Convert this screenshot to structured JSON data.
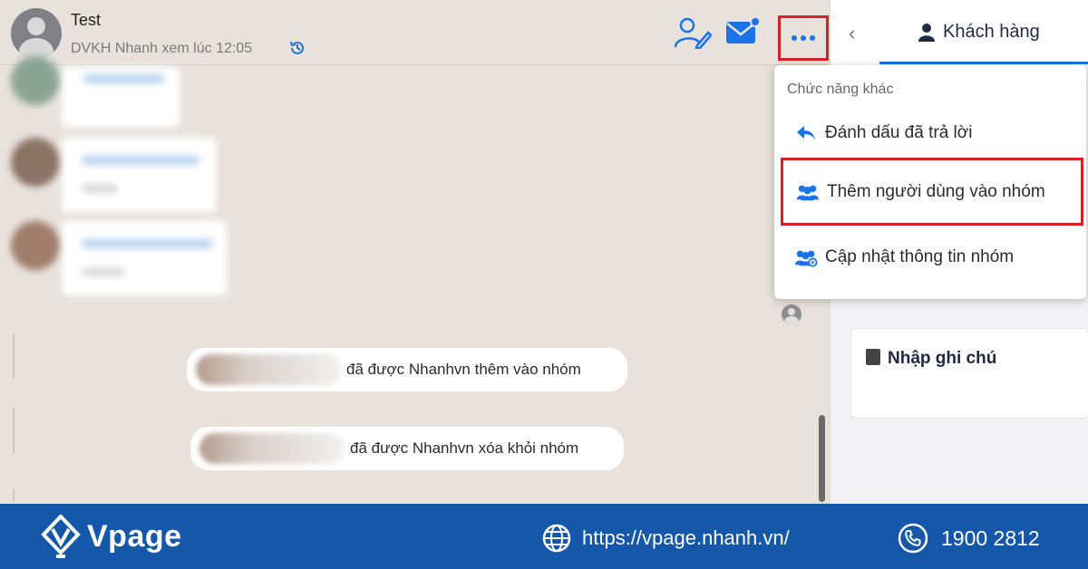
{
  "chat": {
    "title": "Test",
    "subtitle": "DVKH Nhanh xem lúc 12:05",
    "system_messages": [
      "đã được Nhanhvn thêm vào nhóm",
      "đã được Nhanhvn xóa khỏi nhóm"
    ]
  },
  "panel": {
    "tab_label": "Khách hàng",
    "note_placeholder": "Nhập ghi chú"
  },
  "menu": {
    "heading": "Chức năng khác",
    "items": [
      {
        "label": "Đánh dấu đã trả lời",
        "icon": "reply-icon"
      },
      {
        "label": "Thêm người dùng vào nhóm",
        "icon": "users-add-icon"
      },
      {
        "label": "Cập nhật thông tin nhóm",
        "icon": "users-settings-icon"
      }
    ]
  },
  "footer": {
    "brand": "Vpage",
    "url": "https://vpage.nhanh.vn/",
    "phone": "1900 2812"
  },
  "colors": {
    "accent": "#1a73e8",
    "highlight": "#d62027",
    "footer_bg": "#1557a8",
    "chat_bg": "#e9e2dc"
  }
}
